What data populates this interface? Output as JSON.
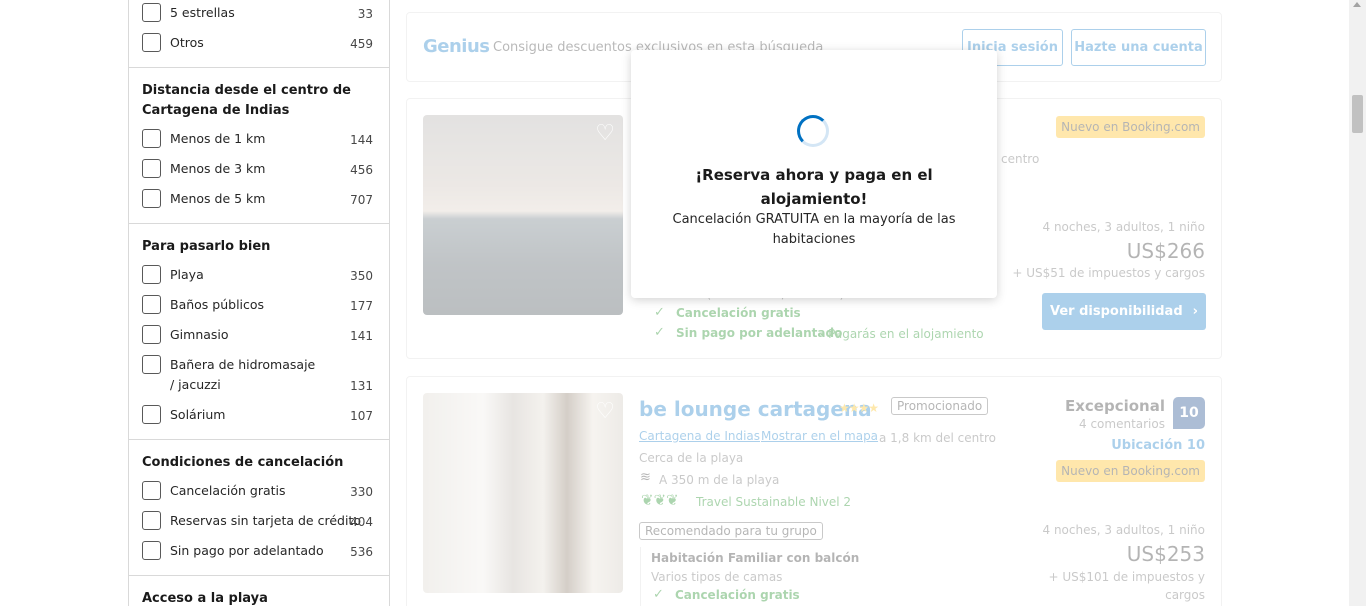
{
  "sidebar": {
    "stars_group": {
      "items": [
        {
          "label": "5 estrellas",
          "count": "33"
        },
        {
          "label": "Otros",
          "count": "459"
        }
      ]
    },
    "distance_group": {
      "title": "Distancia desde el centro de Cartagena de Indias",
      "items": [
        {
          "label": "Menos de 1 km",
          "count": "144"
        },
        {
          "label": "Menos de 3 km",
          "count": "456"
        },
        {
          "label": "Menos de 5 km",
          "count": "707"
        }
      ]
    },
    "fun_group": {
      "title": "Para pasarlo bien",
      "items": [
        {
          "label": "Playa",
          "count": "350"
        },
        {
          "label": "Baños públicos",
          "count": "177"
        },
        {
          "label": "Gimnasio",
          "count": "141"
        },
        {
          "label": "Bañera de hidromasaje / jacuzzi",
          "count": "131"
        },
        {
          "label": "Solárium",
          "count": "107"
        }
      ]
    },
    "cancel_group": {
      "title": "Condiciones de cancelación",
      "items": [
        {
          "label": "Cancelación gratis",
          "count": "330"
        },
        {
          "label": "Reservas sin tarjeta de crédito",
          "count": "404"
        },
        {
          "label": "Sin pago por adelantado",
          "count": "536"
        }
      ]
    },
    "beach_group": {
      "title": "Acceso a la playa"
    }
  },
  "genius": {
    "logo": "Genius",
    "text": "Consigue descuentos exclusivos en esta búsqueda",
    "login_label": "Inicia sesión",
    "signup_label": "Hazte una cuenta"
  },
  "listing1": {
    "badge_new": "Nuevo en Booking.com",
    "distance_fragment": "centro",
    "stay_info": "4 noches, 3 adultos, 1 niño",
    "price": "US$266",
    "taxes": "+ US$51 de impuestos y cargos",
    "beds_fragment": "3 camas (1 individual, 2 dobles)",
    "free_cancel": "Cancelación gratis",
    "no_prepay": "Sin pago por adelantado",
    "pay_at_property": "- Pagarás en el alojamiento",
    "cta_label": "Ver disponibilidad"
  },
  "listing2": {
    "name": "be lounge cartagena",
    "stars": "★★★★",
    "promoted": "Promocionado",
    "rating_word": "Excepcional",
    "review_count": "4 comentarios",
    "score": "10",
    "location_score": "Ubicación 10",
    "badge_new": "Nuevo en Booking.com",
    "city_link": "Cartagena de Indias",
    "map_link": "Mostrar en el mapa",
    "distance": "a 1,8 km del centro",
    "near_beach": "Cerca de la playa",
    "beach_distance": "A 350 m de la playa",
    "sustainable": "Travel Sustainable Nivel 2",
    "recommended": "Recomendado para tu grupo",
    "room_name": "Habitación Familiar con balcón",
    "bed_types": "Varios tipos de camas",
    "free_cancel": "Cancelación gratis",
    "stay_info": "4 noches, 3 adultos, 1 niño",
    "price": "US$253",
    "taxes_line1": "+ US$101 de impuestos y",
    "taxes_line2": "cargos"
  },
  "modal": {
    "title": "¡Reserva ahora y paga en el alojamiento!",
    "text": "Cancelación GRATUITA en la mayoría de las habitaciones"
  },
  "colors": {
    "brand_blue": "#0071c2",
    "dark_blue": "#003580",
    "green": "#008009",
    "yellow": "#ffb700"
  }
}
